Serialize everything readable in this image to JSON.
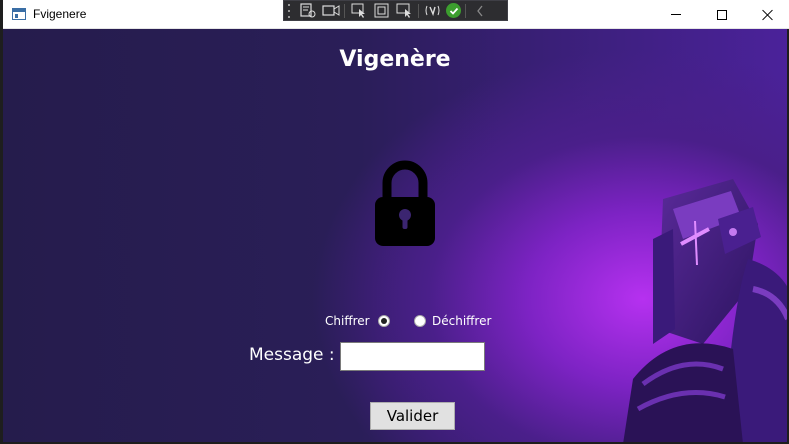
{
  "window": {
    "title": "Fvigenere",
    "minimize_icon": "minimize-icon",
    "maximize_icon": "maximize-icon",
    "close_icon": "close-icon"
  },
  "debug_toolbar": {
    "icons": [
      "live-visual-tree-icon",
      "record-icon",
      "select-element-icon",
      "display-layout-adorners-icon",
      "track-focused-element-icon",
      "hot-reload-icon",
      "hot-reload-status-icon",
      "collapse-icon"
    ]
  },
  "app": {
    "heading": "Vigenère",
    "lock_icon": "lock-icon",
    "mode_options": [
      {
        "label": "Chiffrer",
        "selected": true
      },
      {
        "label": "Déchiffrer",
        "selected": false
      }
    ],
    "message_label": "Message :",
    "message_value": "",
    "submit_label": "Valider"
  },
  "colors": {
    "background_dark": "#251c4c",
    "accent_purple": "#b631f0",
    "hot_reload_green": "#3c9e2e"
  }
}
